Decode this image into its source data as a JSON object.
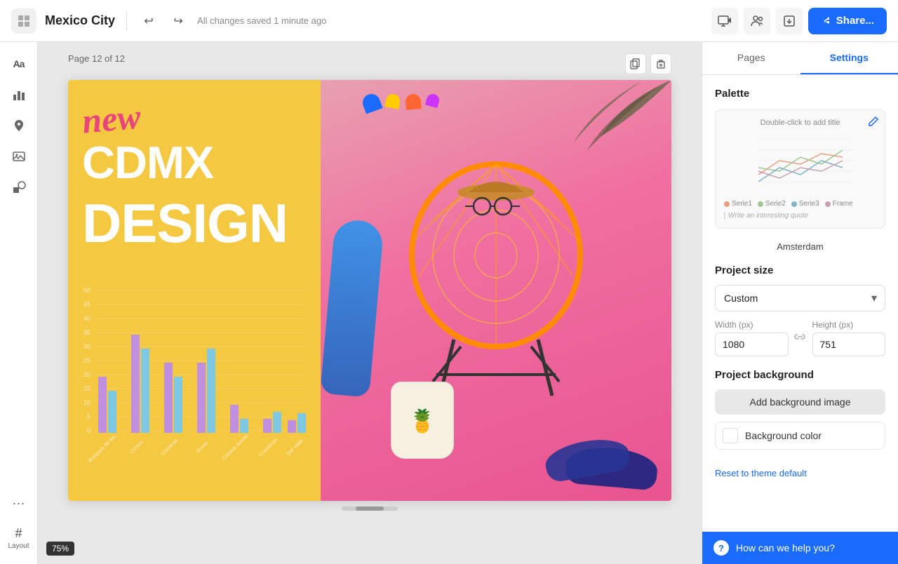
{
  "topbar": {
    "title": "Mexico City",
    "saved_text": "All changes saved 1 minute ago",
    "share_label": "Share...",
    "undo_icon": "↩",
    "redo_icon": "↪"
  },
  "sidebar_left": {
    "icons": [
      {
        "name": "text-icon",
        "glyph": "Aa",
        "active": false
      },
      {
        "name": "chart-icon",
        "glyph": "📊",
        "active": false
      },
      {
        "name": "map-icon",
        "glyph": "🗺",
        "active": false
      },
      {
        "name": "image-icon",
        "glyph": "🖼",
        "active": false
      },
      {
        "name": "shape-icon",
        "glyph": "◧",
        "active": false
      },
      {
        "name": "more-icon",
        "glyph": "···",
        "active": false
      }
    ],
    "layout_label": "Layout",
    "layout_icon": "#"
  },
  "canvas": {
    "page_label": "Page 12 of 12",
    "zoom": "75%",
    "left_text": {
      "new_text": "new",
      "cdmx": "CDMX",
      "design": "DESIGN"
    },
    "chart": {
      "categories": [
        "Bosques de las...",
        "Centro",
        "Condesa",
        "Roma",
        "Colonia Juarez",
        "Coyoacán",
        "Del Valle"
      ],
      "y_labels": [
        "0",
        "5",
        "10",
        "15",
        "20",
        "25",
        "30",
        "35",
        "40",
        "45",
        "50"
      ]
    }
  },
  "right_sidebar": {
    "tabs": [
      {
        "label": "Pages",
        "active": false
      },
      {
        "label": "Settings",
        "active": true
      }
    ],
    "palette_section": {
      "title": "Palette",
      "preview_title": "Double-click to add title",
      "quote_text": "Write an interesting quote",
      "palette_name": "Amsterdam",
      "colors": [
        "#e8b4a0",
        "#c0d4a8",
        "#a8c4d8",
        "#d4a8b4",
        "#b4c8a0"
      ]
    },
    "project_size": {
      "title": "Project size",
      "dropdown_value": "Custom",
      "width_label": "Width (px)",
      "height_label": "Height (px)",
      "width_value": "1080",
      "height_value": "751"
    },
    "project_background": {
      "title": "Project background",
      "add_bg_label": "Add background image",
      "bg_color_label": "Background color"
    },
    "reset_label": "Reset to theme default",
    "help_label": "How can we help you?"
  }
}
